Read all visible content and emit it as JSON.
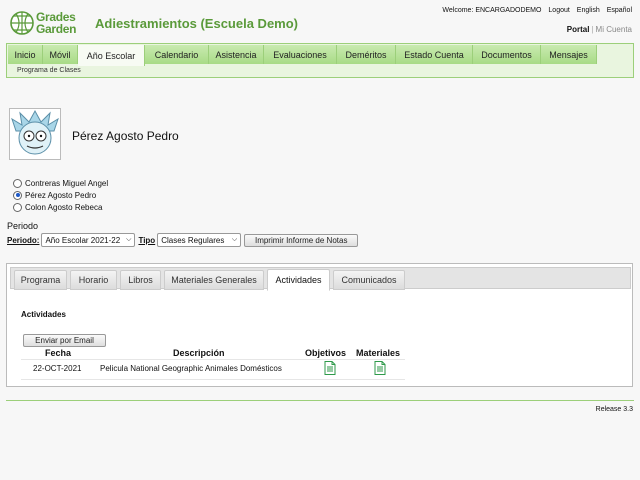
{
  "header": {
    "logo_line1": "Grades",
    "logo_line2": "Garden",
    "title": "Adiestramientos (Escuela Demo)",
    "welcome": "Welcome: ENCARGADODEMO",
    "logout": "Logout",
    "english": "English",
    "espanol": "Español",
    "portal": "Portal",
    "mi_cuenta": "Mi Cuenta"
  },
  "nav": {
    "tabs": [
      "Inicio",
      "Móvil",
      "Año Escolar",
      "Calendario",
      "Asistencia",
      "Evaluaciones",
      "Deméritos",
      "Estado Cuenta",
      "Documentos",
      "Mensajes"
    ],
    "active": "Año Escolar",
    "sub": "Programa de Clases"
  },
  "student": {
    "name": "Pérez Agosto Pedro",
    "options": [
      "Contreras Miguel Angel",
      "Pérez Agosto Pedro",
      "Colon Agosto Rebeca"
    ],
    "selected": "Pérez Agosto Pedro"
  },
  "filters": {
    "section_label": "Periodo",
    "periodo_label": "Periodo:",
    "periodo_value": "Año Escolar 2021-22",
    "tipo_label": "Tipo",
    "tipo_value": "Clases Regulares",
    "print_button": "Imprimir Informe de Notas"
  },
  "panel": {
    "tabs": [
      "Programa",
      "Horario",
      "Libros",
      "Materiales Generales",
      "Actividades",
      "Comunicados"
    ],
    "active_tab": "Actividades",
    "heading": "Actividades",
    "email_button": "Enviar por Email",
    "columns": {
      "fecha": "Fecha",
      "descripcion": "Descripción",
      "objetivos": "Objetivos",
      "materiales": "Materiales"
    },
    "rows": [
      {
        "fecha": "22-OCT-2021",
        "descripcion": "Pelicula National Geographic Animales Domésticos",
        "objetivos_icon": "document-icon",
        "materiales_icon": "document-icon"
      }
    ]
  },
  "footer": {
    "release": "Release 3.3"
  },
  "colors": {
    "brand_green": "#5a9a3a",
    "nav_border": "#9ccf7a",
    "icon_green": "#2e9a4a"
  }
}
